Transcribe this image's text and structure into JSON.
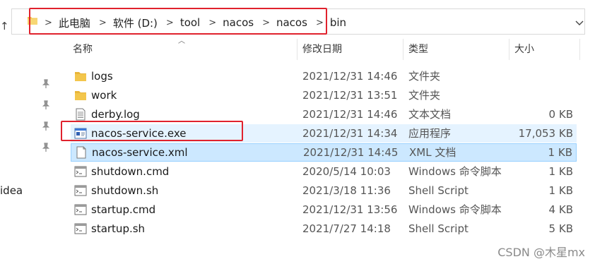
{
  "address_bar": {
    "breadcrumbs": [
      "此电脑",
      "软件 (D:)",
      "tool",
      "nacos",
      "nacos",
      "bin"
    ]
  },
  "nav": {
    "up_glyph": "↑",
    "partial_item": "idea"
  },
  "columns": {
    "name": "名称",
    "date": "修改日期",
    "type": "类型",
    "size": "大小"
  },
  "files": [
    {
      "name": "logs",
      "date": "2021/12/31 14:46",
      "type": "文件夹",
      "size": "",
      "icon": "folder-icon"
    },
    {
      "name": "work",
      "date": "2021/12/31 13:51",
      "type": "文件夹",
      "size": "",
      "icon": "folder-icon"
    },
    {
      "name": "derby.log",
      "date": "2021/12/31 14:46",
      "type": "文本文档",
      "size": "0 KB",
      "icon": "text-file-icon"
    },
    {
      "name": "nacos-service.exe",
      "date": "2021/12/31 14:34",
      "type": "应用程序",
      "size": "17,053 KB",
      "icon": "exe-icon"
    },
    {
      "name": "nacos-service.xml",
      "date": "2021/12/31 14:45",
      "type": "XML 文档",
      "size": "1 KB",
      "icon": "blank-file-icon"
    },
    {
      "name": "shutdown.cmd",
      "date": "2020/5/14 10:03",
      "type": "Windows 命令脚本",
      "size": "1 KB",
      "icon": "script-icon"
    },
    {
      "name": "shutdown.sh",
      "date": "2021/3/18 11:36",
      "type": "Shell Script",
      "size": "1 KB",
      "icon": "script-icon"
    },
    {
      "name": "startup.cmd",
      "date": "2021/12/31 13:56",
      "type": "Windows 命令脚本",
      "size": "4 KB",
      "icon": "script-icon"
    },
    {
      "name": "startup.sh",
      "date": "2021/7/27 14:18",
      "type": "Shell Script",
      "size": "5 KB",
      "icon": "script-icon"
    }
  ],
  "watermark": "CSDN @木星mx",
  "colors": {
    "highlight_red": "#e0222d",
    "hover_row": "#e5f3ff",
    "selected_row": "#cce8ff",
    "folder": "#f3c64c"
  }
}
